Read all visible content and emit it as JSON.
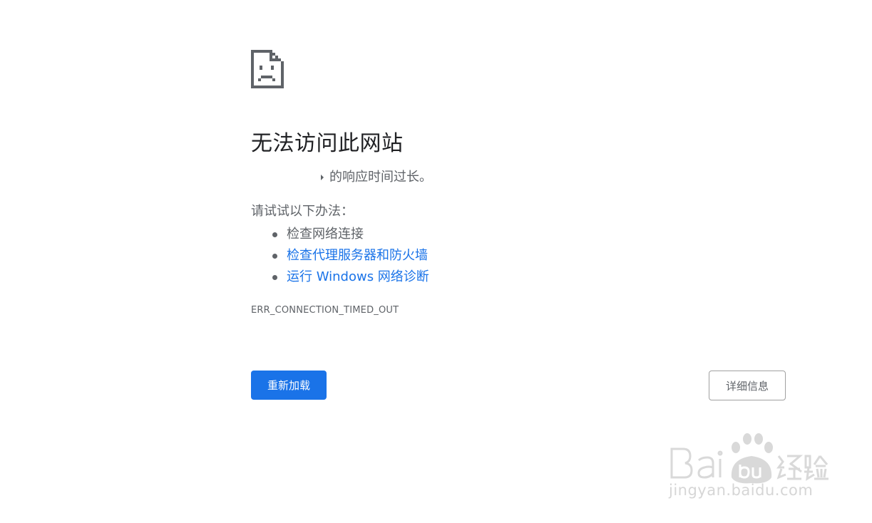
{
  "error_page": {
    "icon": "sad-page-icon",
    "heading": "无法访问此网站",
    "description_suffix": "的响应时间过长。",
    "try_title": "请试试以下办法：",
    "suggestions": [
      {
        "label": "检查网络连接",
        "is_link": false
      },
      {
        "label": "检查代理服务器和防火墙",
        "is_link": true
      },
      {
        "label": "运行 Windows 网络诊断",
        "is_link": true
      }
    ],
    "error_code": "ERR_CONNECTION_TIMED_OUT"
  },
  "buttons": {
    "reload_label": "重新加载",
    "details_label": "详细信息"
  },
  "watermark": {
    "brand": "Bai du 经验",
    "url": "jingyan.baidu.com"
  },
  "colors": {
    "accent": "#1a73e8",
    "text_primary": "#202124",
    "text_secondary": "#5f6368",
    "icon": "#5f6368",
    "background": "#ffffff"
  }
}
